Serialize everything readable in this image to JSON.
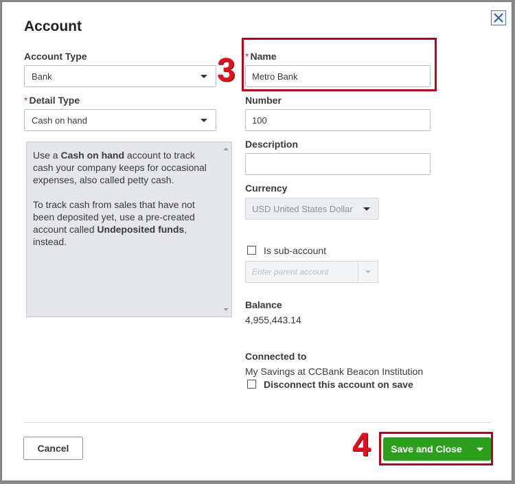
{
  "dialog": {
    "title": "Account",
    "close_icon": "close-icon"
  },
  "account_type": {
    "label": "Account Type",
    "value": "Bank"
  },
  "detail_type": {
    "required_mark": "*",
    "label": "Detail Type",
    "value": "Cash on hand"
  },
  "description_box": {
    "p1_prefix": "Use a ",
    "p1_bold": "Cash on hand",
    "p1_suffix": " account to track cash your company keeps for occasional expenses, also called petty cash.",
    "p2_prefix": "To track cash from sales that have not been deposited yet, use a pre-created account called ",
    "p2_bold": "Undeposited funds",
    "p2_suffix": ", instead."
  },
  "name": {
    "required_mark": "*",
    "label": "Name",
    "value": "Metro Bank"
  },
  "number": {
    "label": "Number",
    "value": "100"
  },
  "description": {
    "label": "Description",
    "value": ""
  },
  "currency": {
    "label": "Currency",
    "value": "USD United States Dollar"
  },
  "sub_account": {
    "label": "Is sub-account",
    "checked": false,
    "parent_placeholder": "Enter parent account"
  },
  "balance": {
    "label": "Balance",
    "value": "4,955,443.14"
  },
  "connected": {
    "label": "Connected to",
    "value": "My Savings at CCBank Beacon Institution",
    "disconnect_label": "Disconnect this account on save",
    "disconnect_checked": false
  },
  "footer": {
    "cancel_label": "Cancel",
    "save_label": "Save and Close"
  },
  "annotations": {
    "step_name": "3",
    "step_save": "4",
    "highlight_color": "#c0001a"
  },
  "colors": {
    "accent_green": "#2ca01c",
    "required_red": "#d52b1e"
  }
}
